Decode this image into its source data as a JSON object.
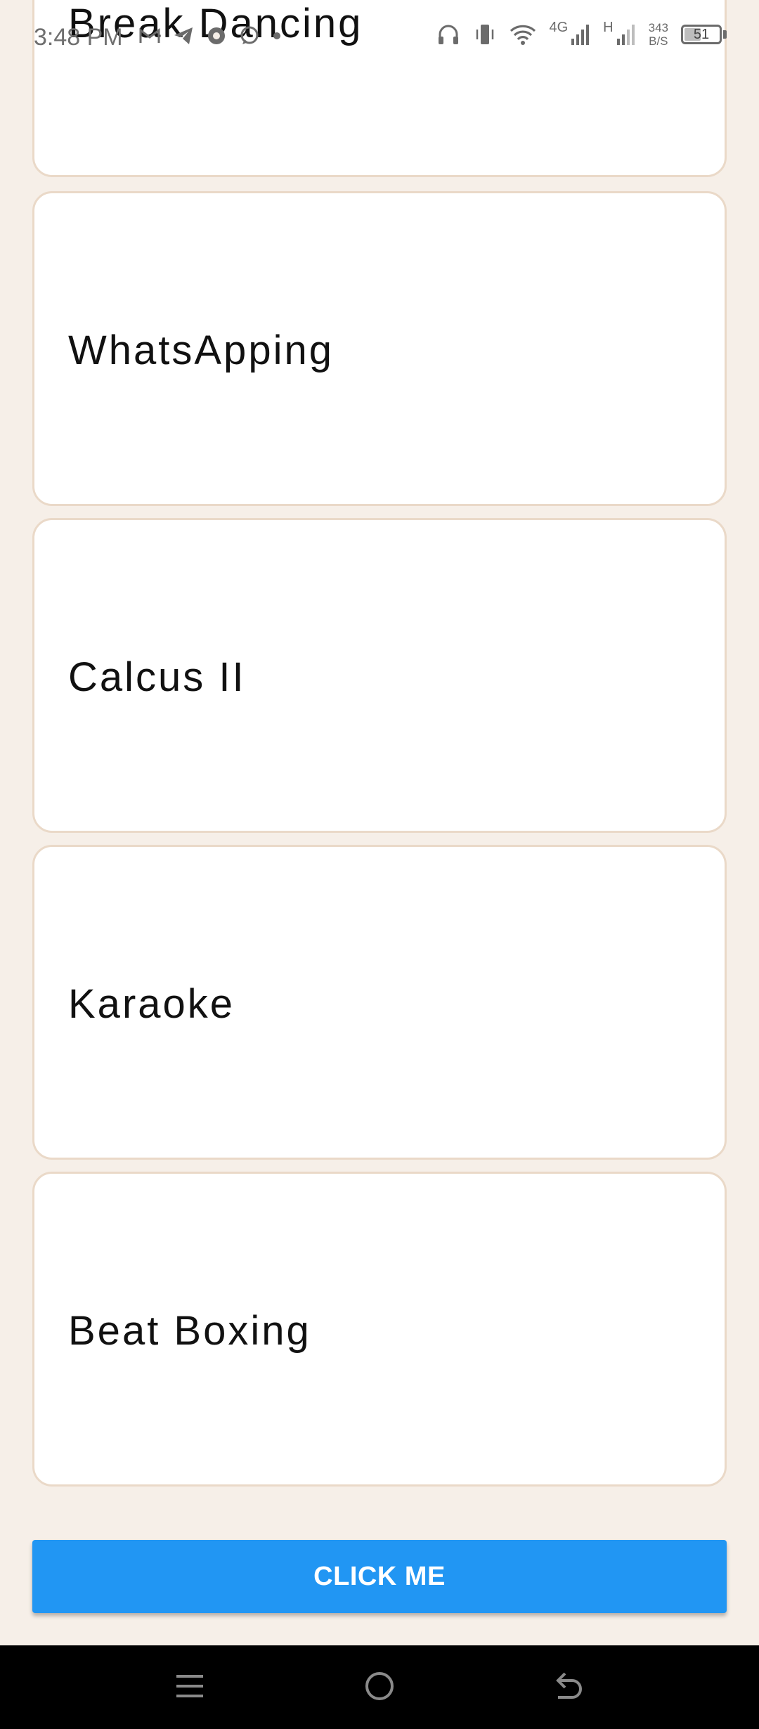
{
  "status_bar": {
    "time": "3:48 PM",
    "network_4g": "4G",
    "network_h": "H",
    "speed_value": "343",
    "speed_unit": "B/S",
    "battery_level": "51",
    "battery_fraction": 0.51
  },
  "activities": [
    {
      "label": "Break Dancing"
    },
    {
      "label": "WhatsApping"
    },
    {
      "label": "Calcus II"
    },
    {
      "label": "Karaoke"
    },
    {
      "label": "Beat Boxing"
    }
  ],
  "button": {
    "label": "CLICK ME",
    "color": "#2196f3"
  },
  "colors": {
    "background": "#f6efe8",
    "card_border": "#ead9c8",
    "card_background": "#ffffff",
    "nav_bar": "#000000"
  },
  "icons": {
    "status_left": [
      "gmail-icon",
      "telegram-icon",
      "chrome-icon",
      "whatsapp-icon",
      "dot-icon"
    ],
    "status_right": [
      "headphones-icon",
      "vibrate-icon",
      "wifi-icon",
      "signal-4g-icon",
      "signal-h-icon",
      "battery-icon"
    ],
    "nav": [
      "menu-icon",
      "home-icon",
      "back-icon"
    ]
  }
}
